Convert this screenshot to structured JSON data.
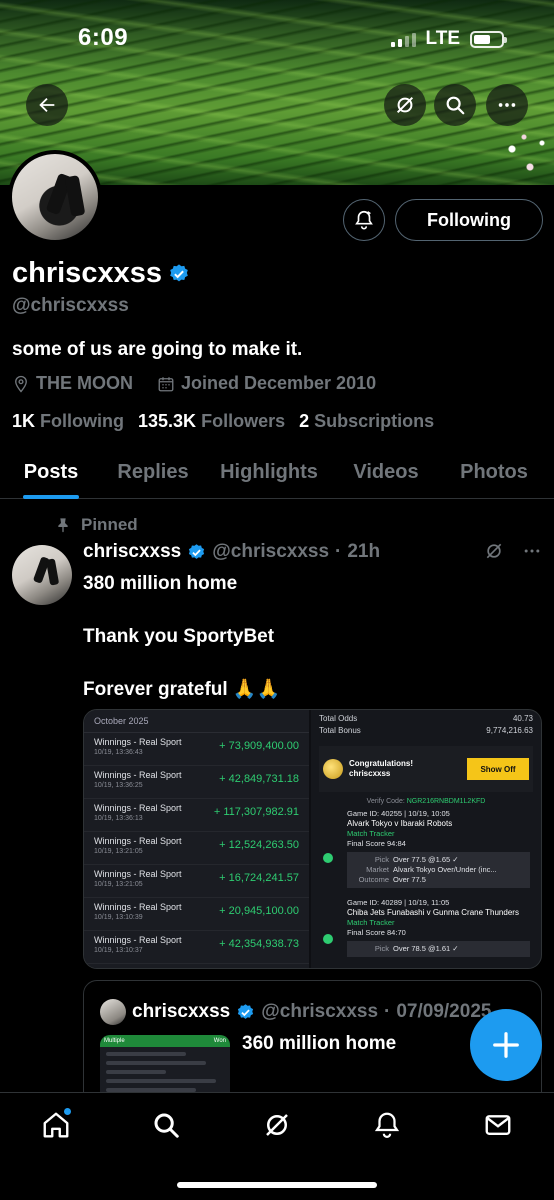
{
  "status_bar": {
    "time": "6:09",
    "network": "LTE"
  },
  "profile": {
    "display_name": "chriscxxss",
    "handle": "@chriscxxss",
    "bio": "some of us are going to make it.",
    "location": "THE MOON",
    "joined": "Joined December 2010",
    "following_count": "1K",
    "following_label": "Following",
    "followers_count": "135.3K",
    "followers_label": "Followers",
    "subscriptions_count": "2",
    "subscriptions_label": "Subscriptions",
    "follow_button": "Following"
  },
  "tabs": [
    {
      "label": "Posts",
      "active": true
    },
    {
      "label": "Replies",
      "active": false
    },
    {
      "label": "Highlights",
      "active": false
    },
    {
      "label": "Videos",
      "active": false
    },
    {
      "label": "Photos",
      "active": false
    }
  ],
  "pinned_post": {
    "pinned_label": "Pinned",
    "author_name": "chriscxxss",
    "author_handle": "@chriscxxss",
    "time": "21h",
    "lines": [
      "380 million home",
      "Thank you SportyBet",
      "Forever grateful 🙏🙏"
    ]
  },
  "bet_image": {
    "month": "October 2025",
    "winnings": [
      {
        "title": "Winnings - Real Sport",
        "date": "10/19, 13:36:43",
        "amount": "+ 73,909,400.00"
      },
      {
        "title": "Winnings - Real Sport",
        "date": "10/19, 13:36:25",
        "amount": "+ 42,849,731.18"
      },
      {
        "title": "Winnings - Real Sport",
        "date": "10/19, 13:36:13",
        "amount": "+ 117,307,982.91"
      },
      {
        "title": "Winnings - Real Sport",
        "date": "10/19, 13:21:05",
        "amount": "+ 12,524,263.50"
      },
      {
        "title": "Winnings - Real Sport",
        "date": "10/19, 13:21:05",
        "amount": "+ 16,724,241.57"
      },
      {
        "title": "Winnings - Real Sport",
        "date": "10/19, 13:10:39",
        "amount": "+ 20,945,100.00"
      },
      {
        "title": "Winnings - Real Sport",
        "date": "10/19, 13:10:37",
        "amount": "+ 42,354,938.73"
      }
    ],
    "total_odds_label": "Total Odds",
    "total_odds": "40.73",
    "total_bonus_label": "Total Bonus",
    "total_bonus": "9,774,216.63",
    "congrats": "Congratulations!",
    "congrats_user": "chriscxxss",
    "show_off": "Show Off",
    "verify_label": "Verify Code:",
    "verify_code": "NGR216RNBDM1L2KFD",
    "game1": {
      "id": "Game ID: 40255 | 10/19, 10:05",
      "teams": "Alvark Tokyo v Ibaraki Robots",
      "tracker": "Match Tracker",
      "final_score": "Final Score  94:84",
      "pick_label": "Pick",
      "pick": "Over 77.5 @1.65 ✓",
      "market_label": "Market",
      "market": "Alvark Tokyo Over/Under (inc...",
      "outcome_label": "Outcome",
      "outcome": "Over 77.5"
    },
    "game2": {
      "id": "Game ID: 40289 | 10/19, 11:05",
      "teams": "Chiba Jets Funabashi v Gunma Crane Thunders",
      "tracker": "Match Tracker",
      "final_score": "Final Score  84:70",
      "pick_label": "Pick",
      "pick": "Over 78.5 @1.61 ✓"
    }
  },
  "quote_post": {
    "author_name": "chriscxxss",
    "author_handle": "@chriscxxss",
    "date": "07/09/2025",
    "text": "360 million home",
    "thumb_header_left": "Multiple",
    "thumb_header_right": "Won"
  },
  "colors": {
    "accent": "#1d9bf0",
    "muted": "#71767b",
    "win_green": "#2ecc71"
  },
  "nav": [
    "home-icon",
    "search-icon",
    "grok-icon",
    "notifications-icon",
    "messages-icon"
  ]
}
